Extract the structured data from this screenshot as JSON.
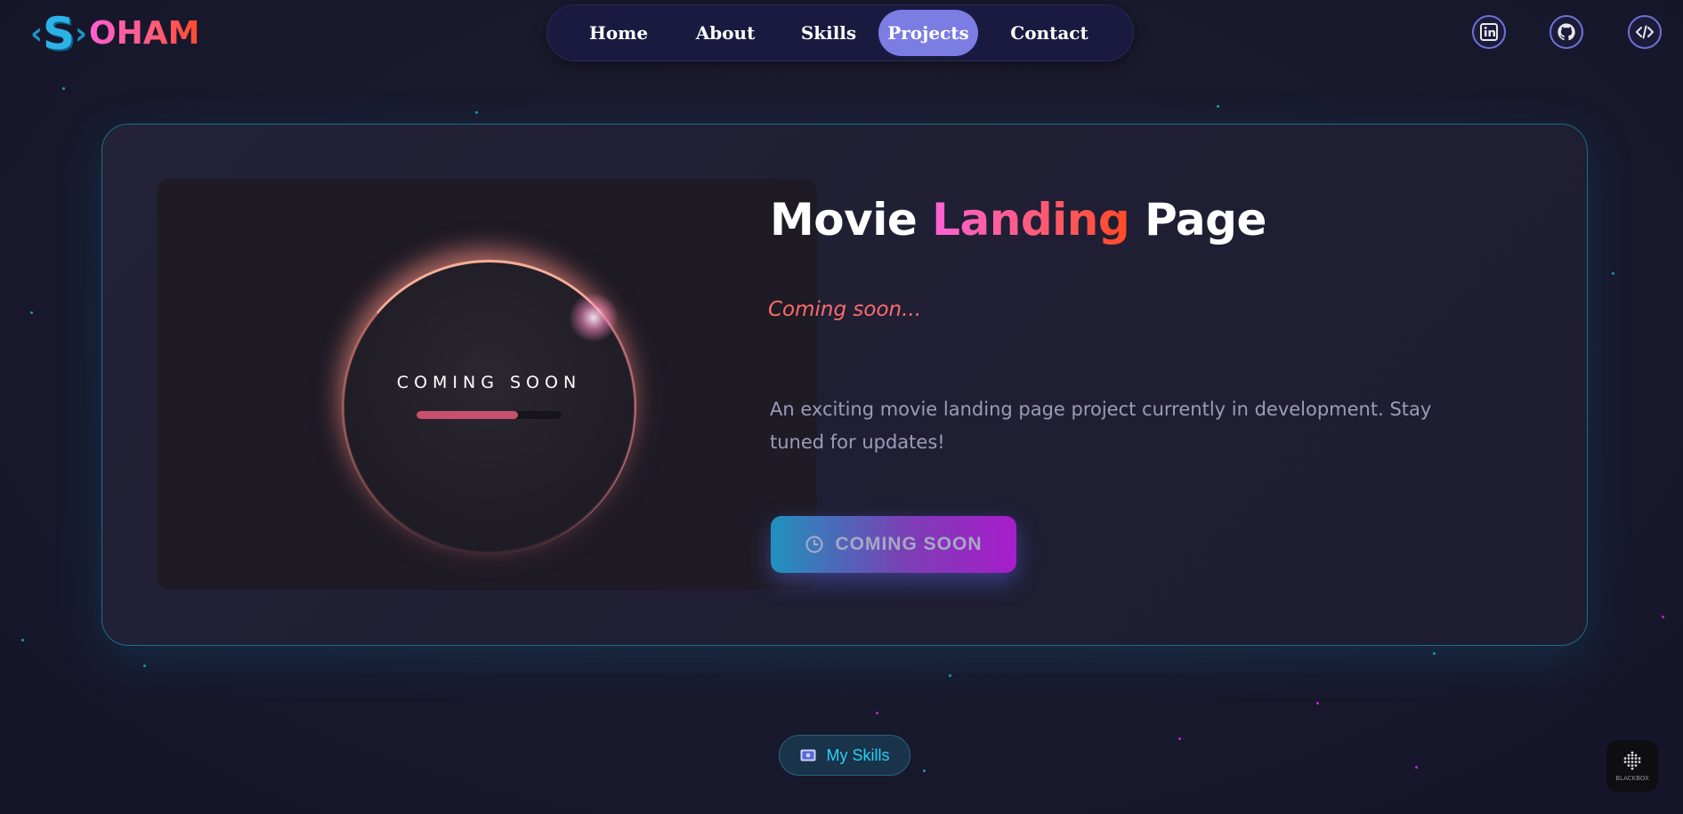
{
  "brand": {
    "logo_left": "‹",
    "logo_s": "S",
    "logo_right": "›",
    "logo_text": "OHAM"
  },
  "nav": {
    "items": [
      {
        "label": "Home"
      },
      {
        "label": "About"
      },
      {
        "label": "Skills"
      },
      {
        "label": "Projects",
        "active": true
      },
      {
        "label": "Contact"
      }
    ],
    "active_color": "#7b7de3"
  },
  "social": [
    {
      "icon": "linkedin-icon"
    },
    {
      "icon": "github-icon"
    },
    {
      "icon": "code-icon"
    }
  ],
  "project": {
    "preview_text": "COMING SOON",
    "preview_progress": 0.7,
    "title_part1": "Movie",
    "title_highlight": "Landing",
    "title_part2": "Page",
    "status": "Coming soon...",
    "description": "An exciting movie landing page project currently in development. Stay tuned for updates!",
    "cta_label": "COMING SOON",
    "cta_icon": "clock-icon"
  },
  "footer": {
    "skills_label": "My Skills",
    "skills_icon": "id-card-icon",
    "badge_label": "BLACKBOX"
  },
  "colors": {
    "background": "#1a1a2e",
    "accent": "#7b7de3",
    "status": "#ff6b6b",
    "skills_text": "#2ad0f5"
  }
}
